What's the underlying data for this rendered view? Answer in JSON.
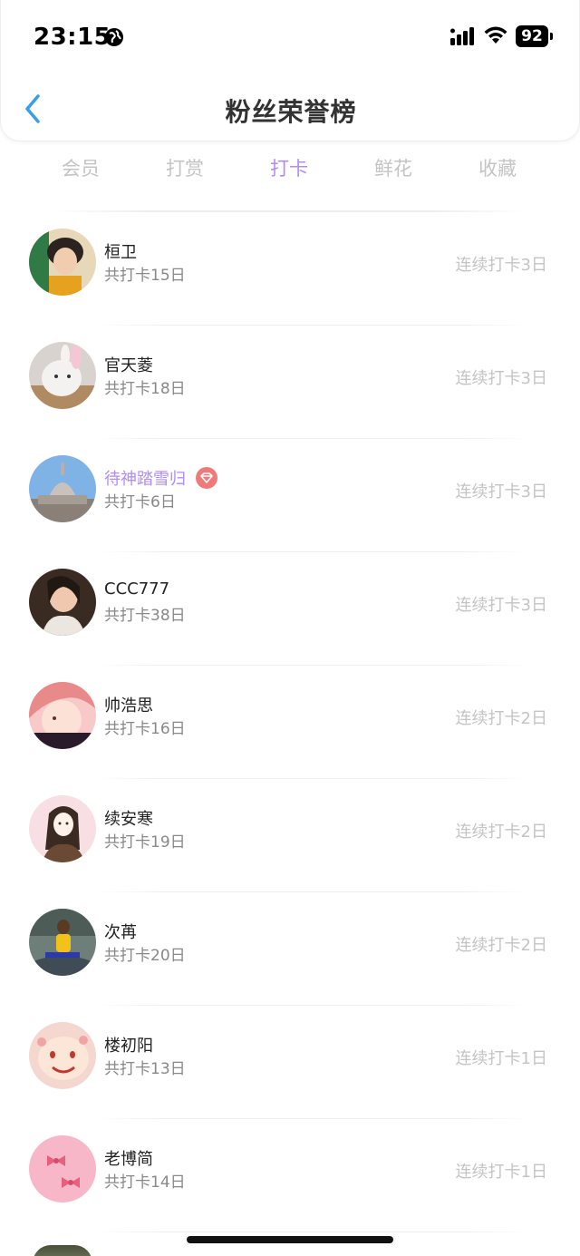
{
  "status_bar": {
    "time": "23:15",
    "battery": "92"
  },
  "header": {
    "title": "粉丝荣誉榜"
  },
  "tabs": [
    {
      "label": "会员",
      "active": false
    },
    {
      "label": "打赏",
      "active": false
    },
    {
      "label": "打卡",
      "active": true
    },
    {
      "label": "鲜花",
      "active": false
    },
    {
      "label": "收藏",
      "active": false
    }
  ],
  "colors": {
    "accent": "#b38cf0",
    "back_arrow": "#3a9ee8",
    "muted": "#c4c4c4",
    "vip_badge": "#f07a7a"
  },
  "fans": [
    {
      "name": "桓卫",
      "total": "共打卡15日",
      "streak": "连续打卡3日",
      "vip": false
    },
    {
      "name": "官天菱",
      "total": "共打卡18日",
      "streak": "连续打卡3日",
      "vip": false
    },
    {
      "name": "待神踏雪归",
      "total": "共打卡6日",
      "streak": "连续打卡3日",
      "vip": true
    },
    {
      "name": "CCC777",
      "total": "共打卡38日",
      "streak": "连续打卡3日",
      "vip": false
    },
    {
      "name": "帅浩思",
      "total": "共打卡16日",
      "streak": "连续打卡2日",
      "vip": false
    },
    {
      "name": "续安寒",
      "total": "共打卡19日",
      "streak": "连续打卡2日",
      "vip": false
    },
    {
      "name": "次苒",
      "total": "共打卡20日",
      "streak": "连续打卡2日",
      "vip": false
    },
    {
      "name": "楼初阳",
      "total": "共打卡13日",
      "streak": "连续打卡1日",
      "vip": false
    },
    {
      "name": "老博简",
      "total": "共打卡14日",
      "streak": "连续打卡1日",
      "vip": false
    }
  ]
}
